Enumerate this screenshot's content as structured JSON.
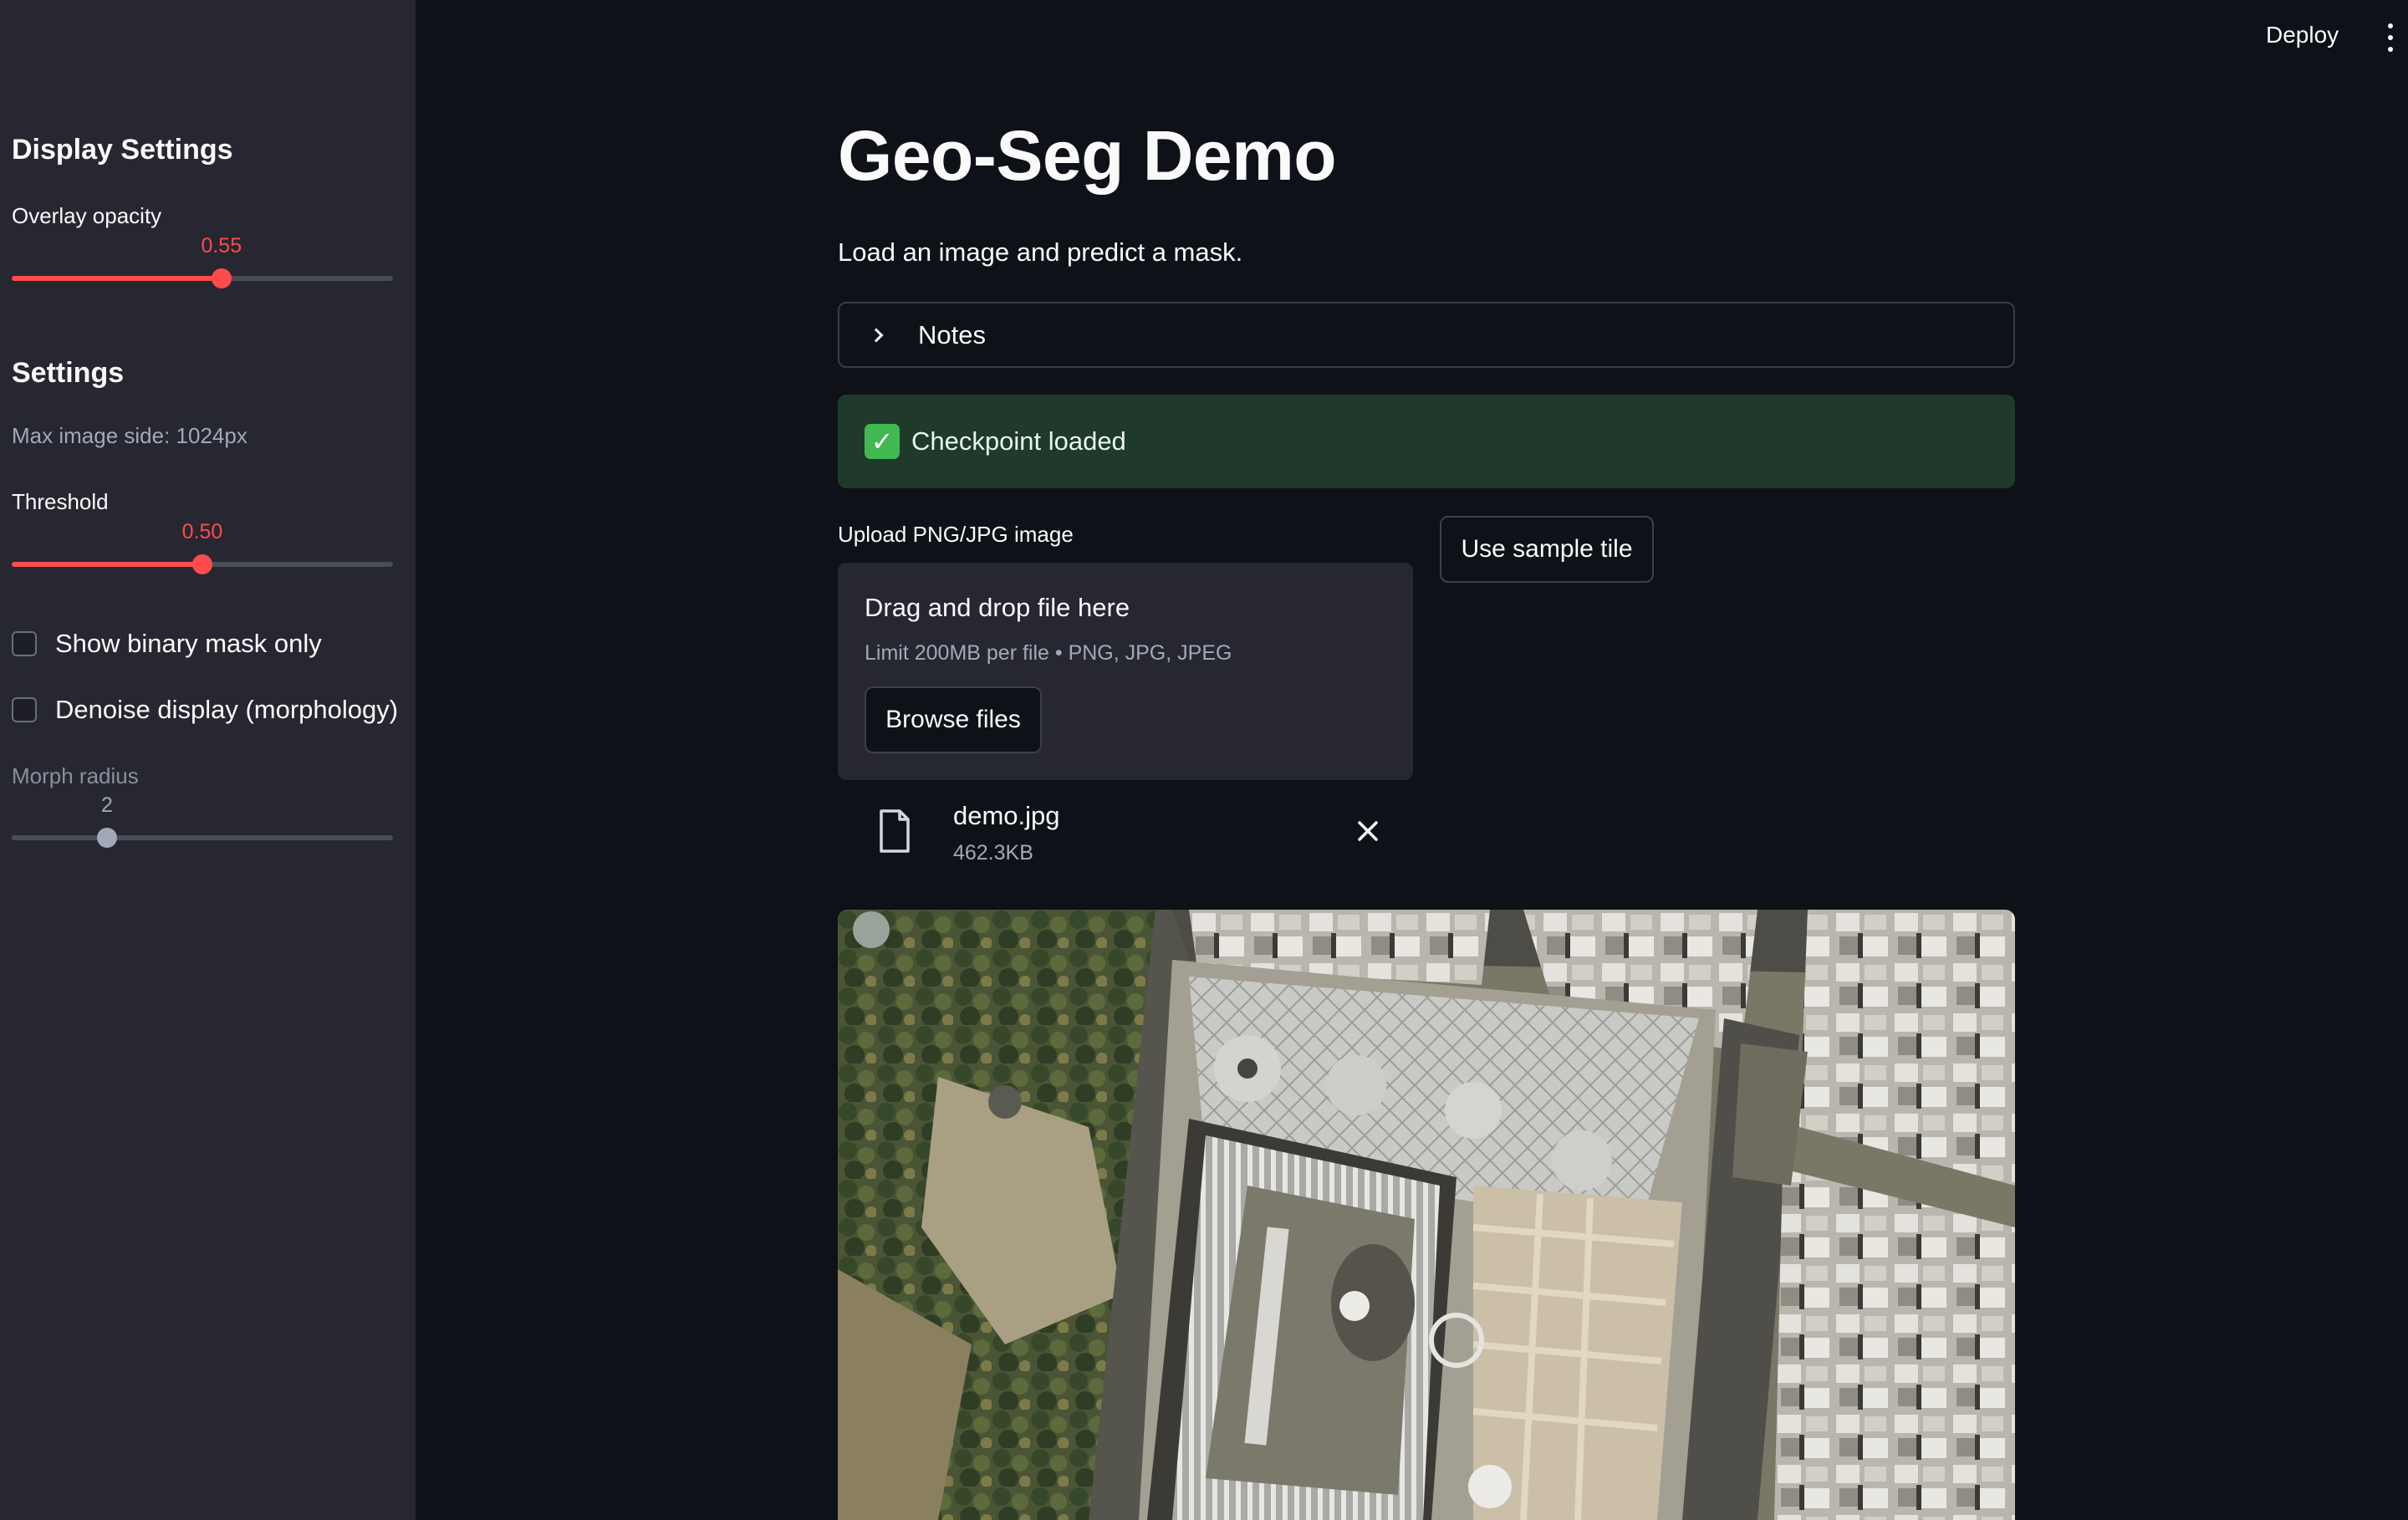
{
  "topbar": {
    "deploy_label": "Deploy",
    "menu_icon": "kebab-menu-icon"
  },
  "sidebar": {
    "display_settings": {
      "heading": "Display Settings",
      "overlay_opacity": {
        "label": "Overlay opacity",
        "value": "0.55",
        "fraction": 0.55
      }
    },
    "settings": {
      "heading": "Settings",
      "max_image_side": "Max image side: 1024px",
      "threshold": {
        "label": "Threshold",
        "value": "0.50",
        "fraction": 0.5
      },
      "show_binary_mask": {
        "label": "Show binary mask only",
        "checked": false
      },
      "denoise_display": {
        "label": "Denoise display (morphology)",
        "checked": false
      },
      "morph_radius": {
        "label": "Morph radius",
        "value": "2",
        "fraction": 0.25,
        "disabled": true
      }
    }
  },
  "main": {
    "title": "Geo-Seg Demo",
    "subtitle": "Load an image and predict a mask.",
    "notes_expander": {
      "label": "Notes",
      "expanded": false
    },
    "status_alert": {
      "text": "Checkpoint loaded",
      "icon": "check-mark-icon"
    },
    "uploader": {
      "label": "Upload PNG/JPG image",
      "drop_title": "Drag and drop file here",
      "limit_text": "Limit 200MB per file • PNG, JPG, JPEG",
      "browse_label": "Browse files"
    },
    "sample_button_label": "Use sample tile",
    "uploaded_file": {
      "name": "demo.jpg",
      "size": "462.3KB",
      "icon": "file-icon",
      "remove_icon": "close-icon"
    },
    "preview_image": "aerial-photo-urban-plaza"
  },
  "colors": {
    "background": "#0e1117",
    "sidebar": "#262730",
    "accent": "#ff4b4b",
    "success_bg": "#1f3a2a",
    "success_icon": "#3fb950"
  }
}
